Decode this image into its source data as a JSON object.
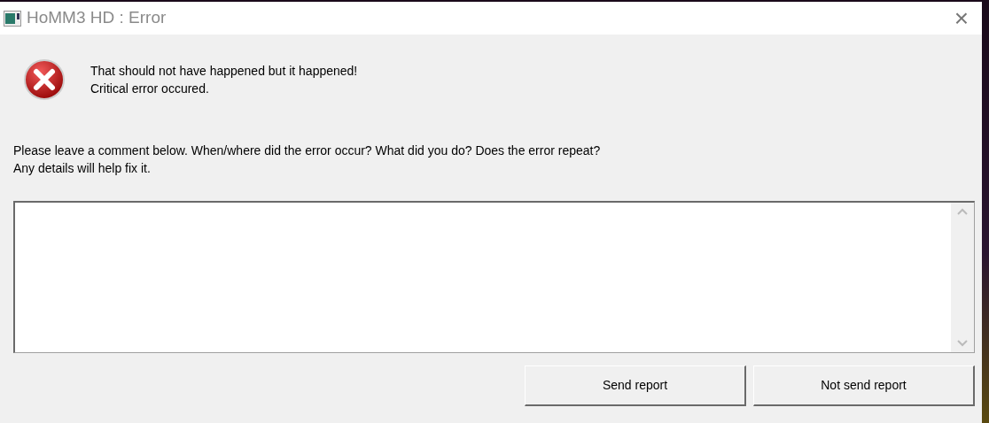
{
  "window": {
    "title": "HoMM3 HD : Error",
    "close": "×"
  },
  "message": [
    "That should not have happened but it happened!",
    "Critical error occured."
  ],
  "prompt": [
    "Please leave a comment below. When/where did the error occur? What did you do? Does the error repeat?",
    "Any details will help fix it."
  ],
  "buttons": [
    "Send report",
    "Not send report"
  ]
}
